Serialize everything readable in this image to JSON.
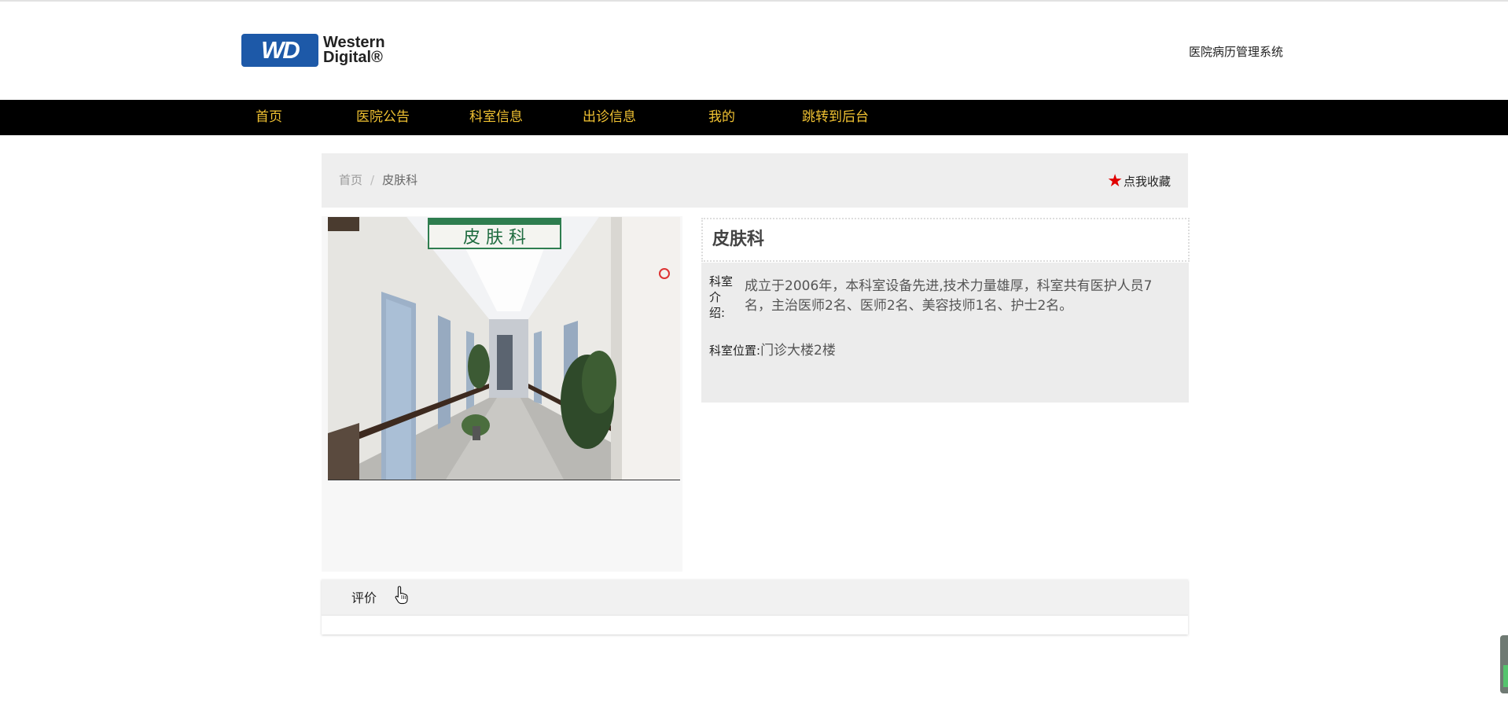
{
  "header": {
    "logo": {
      "badge_text": "WD",
      "line1": "Western",
      "line2": "Digital®"
    },
    "site_title": "医院病历管理系统"
  },
  "nav": {
    "items": [
      {
        "label": "首页"
      },
      {
        "label": "医院公告"
      },
      {
        "label": "科室信息"
      },
      {
        "label": "出诊信息"
      },
      {
        "label": "我的"
      },
      {
        "label": "跳转到后台"
      }
    ],
    "text_color": "#f1c232",
    "background": "#000000"
  },
  "breadcrumb": {
    "home": "首页",
    "separator": "/",
    "current": "皮肤科"
  },
  "favorite": {
    "label": "点我收藏",
    "icon": "star-icon",
    "icon_color": "#e00000"
  },
  "department": {
    "name": "皮肤科",
    "photo_sign": "皮 肤 科",
    "intro_label": "科室介绍:",
    "intro_text": "成立于2006年，本科室设备先进,技术力量雄厚，科室共有医护人员7名，主治医师2名、医师2名、美容技师1名、护士2名。",
    "location_label": "科室位置:",
    "location_value": "门诊大楼2楼"
  },
  "reviews": {
    "tab_label": "评价"
  }
}
